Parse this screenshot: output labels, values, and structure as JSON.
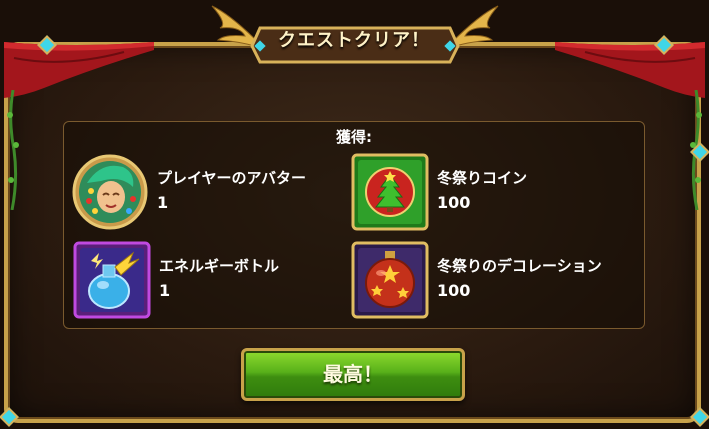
{
  "dialog": {
    "title": "クエストクリア！",
    "rewards_label": "獲得:",
    "confirm_button": "最高！"
  },
  "rewards": [
    {
      "name": "プレイヤーのアバター",
      "quantity": "1",
      "icon": "avatar-portrait-icon"
    },
    {
      "name": "冬祭りコイン",
      "quantity": "100",
      "icon": "christmas-tree-coin-icon"
    },
    {
      "name": "エネルギーボトル",
      "quantity": "1",
      "icon": "energy-bottle-icon"
    },
    {
      "name": "冬祭りのデコレーション",
      "quantity": "100",
      "icon": "ornament-ball-icon"
    }
  ],
  "colors": {
    "frame_gold": "#c8a24a",
    "panel_bg": "#2a1a0f",
    "button_green": "#58b01a",
    "gem_cyan": "#3fd6e8"
  }
}
